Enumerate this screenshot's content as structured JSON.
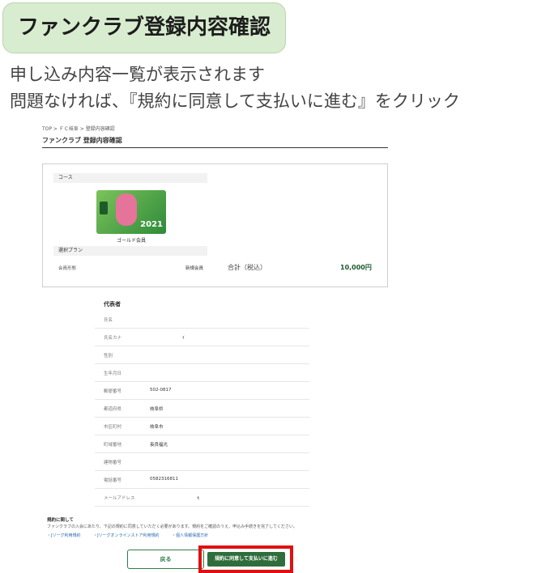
{
  "header": {
    "title": "ファンクラブ登録内容確認"
  },
  "instructions": [
    "申し込み内容一覧が表示されます",
    "問題なければ、『規約に同意して支払いに進む』をクリック"
  ],
  "screenshot": {
    "breadcrumb": "TOP > ＦＣ岐阜 > 登録内容確認",
    "page_title": "ファンクラブ 登録内容確認",
    "course_label": "コース",
    "card": {
      "year": "2021",
      "name": "ゴールド会員"
    },
    "plan_label": "選択プラン",
    "plan_row": {
      "label": "会員形態",
      "value": "新規会員"
    },
    "total": {
      "label": "合計（税込）",
      "amount": "10,000円"
    },
    "representative": {
      "heading": "代表者",
      "rows": [
        {
          "label": "氏名",
          "value": ""
        },
        {
          "label": "氏名カナ",
          "value": "ｲ"
        },
        {
          "label": "性別",
          "value": ""
        },
        {
          "label": "生年月日",
          "value": ""
        },
        {
          "label": "郵便番号",
          "value": "502-0817"
        },
        {
          "label": "都道府県",
          "value": "岐阜県"
        },
        {
          "label": "市区町村",
          "value": "岐阜市"
        },
        {
          "label": "町域番地",
          "value": "長良福光"
        },
        {
          "label": "建物番号",
          "value": ""
        },
        {
          "label": "電話番号",
          "value": "0582316811"
        },
        {
          "label": "メールアドレス",
          "value": "ｔ"
        }
      ]
    },
    "terms": {
      "heading": "規約に関して",
      "text": "ファンクラブの入会にあたり、下記の規約に同意していただく必要があります。規約をご確認のうえ、申込み手続きを完了してください。",
      "links": [
        "・Jリーグ利用規約",
        "・Jリーグオンラインストア利用規約",
        "・個人情報保護方針"
      ]
    },
    "buttons": {
      "back": "戻る",
      "agree": "規約に同意して支払いに進む"
    }
  },
  "colors": {
    "accent_green": "#2f6e3c",
    "highlight_red": "#e01010",
    "title_bg": "#d8eccf"
  }
}
